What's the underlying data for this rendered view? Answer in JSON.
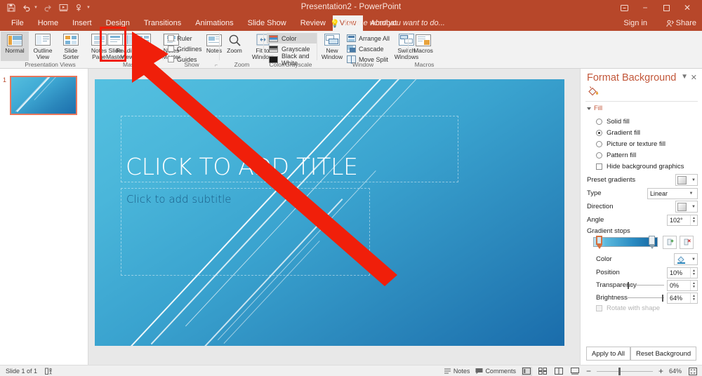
{
  "window": {
    "title": "Presentation2 - PowerPoint",
    "quick_access": [
      "save-icon",
      "undo-icon",
      "redo-icon",
      "start-presentation-icon",
      "touch-mode-icon",
      "customize-qat-icon"
    ],
    "controls": [
      "ribbon-display-options-icon",
      "minimize-icon",
      "restore-icon",
      "close-icon"
    ],
    "sign_in": "Sign in",
    "share": "Share",
    "accent_color": "#b7472a"
  },
  "tabs": [
    {
      "label": "File",
      "active": false
    },
    {
      "label": "Home",
      "active": false
    },
    {
      "label": "Insert",
      "active": false
    },
    {
      "label": "Design",
      "active": false
    },
    {
      "label": "Transitions",
      "active": false
    },
    {
      "label": "Animations",
      "active": false
    },
    {
      "label": "Slide Show",
      "active": false
    },
    {
      "label": "Review",
      "active": false
    },
    {
      "label": "View",
      "active": true
    },
    {
      "label": "Acrobat",
      "active": false
    }
  ],
  "tell_me": "Tell me what you want to do...",
  "ribbon": {
    "groups": [
      {
        "name": "Presentation Views",
        "label": "Presentation Views",
        "buttons": [
          {
            "label": "Normal",
            "selected": true
          },
          {
            "label": "Outline View",
            "selected": false
          },
          {
            "label": "Slide Sorter",
            "selected": false
          },
          {
            "label": "Notes Page",
            "selected": false
          },
          {
            "label": "Reading View",
            "selected": false
          }
        ]
      },
      {
        "name": "Master",
        "label": "Master",
        "buttons": [
          {
            "label": "Slide Master",
            "selected": false,
            "highlighted": true
          },
          {
            "label": "Handout Master",
            "selected": false
          },
          {
            "label": "Notes Master",
            "selected": false
          }
        ]
      },
      {
        "name": "Show",
        "label": "Show",
        "checkboxes": [
          {
            "label": "Ruler",
            "checked": false
          },
          {
            "label": "Gridlines",
            "checked": false
          },
          {
            "label": "Guides",
            "checked": false
          }
        ],
        "buttons": [
          {
            "label": "Notes",
            "selected": false
          }
        ],
        "has_dialog_launcher": true
      },
      {
        "name": "Zoom",
        "label": "Zoom",
        "buttons": [
          {
            "label": "Zoom",
            "selected": false
          },
          {
            "label": "Fit to Window",
            "selected": false
          }
        ]
      },
      {
        "name": "Color/Grayscale",
        "label": "Color/Grayscale",
        "options": [
          {
            "label": "Color",
            "selected": true
          },
          {
            "label": "Grayscale",
            "selected": false
          },
          {
            "label": "Black and White",
            "selected": false
          }
        ]
      },
      {
        "name": "Window",
        "label": "Window",
        "buttons": [
          {
            "label": "New Window",
            "selected": false
          },
          {
            "label": "Switch Windows",
            "selected": false
          }
        ],
        "items": [
          {
            "label": "Arrange All"
          },
          {
            "label": "Cascade"
          },
          {
            "label": "Move Split"
          }
        ]
      },
      {
        "name": "Macros",
        "label": "Macros",
        "buttons": [
          {
            "label": "Macros",
            "selected": false
          }
        ]
      }
    ]
  },
  "thumbnails": {
    "slides": [
      {
        "number": "1",
        "selected": true
      }
    ]
  },
  "slide": {
    "title_placeholder": "CLICK TO ADD TITLE",
    "subtitle_placeholder": "Click to add subtitle",
    "gradient_from": "#55c0e0",
    "gradient_to": "#1a6cab"
  },
  "format_pane": {
    "title": "Format Background",
    "section_fill": "Fill",
    "fill_options": [
      {
        "label": "Solid fill",
        "selected": false
      },
      {
        "label": "Gradient fill",
        "selected": true
      },
      {
        "label": "Picture or texture fill",
        "selected": false
      },
      {
        "label": "Pattern fill",
        "selected": false
      }
    ],
    "hide_background_graphics": {
      "label": "Hide background graphics",
      "checked": false
    },
    "preset_gradients_label": "Preset gradients",
    "type_label": "Type",
    "type_value": "Linear",
    "direction_label": "Direction",
    "angle_label": "Angle",
    "angle_value": "102°",
    "gradient_stops_label": "Gradient stops",
    "color_label": "Color",
    "position_label": "Position",
    "position_value": "10%",
    "transparency_label": "Transparency",
    "transparency_value": "0%",
    "brightness_label": "Brightness",
    "brightness_value": "64%",
    "rotate_with_shape": {
      "label": "Rotate with shape",
      "checked": false,
      "disabled": true
    },
    "apply_to_all": "Apply to All",
    "reset_background": "Reset Background"
  },
  "status_bar": {
    "slide_counter": "Slide 1 of 1",
    "accessibility_icon": "accessibility-checker-icon",
    "notes": "Notes",
    "comments": "Comments",
    "views": [
      "normal-view-icon",
      "slide-sorter-icon",
      "reading-view-icon",
      "slideshow-icon"
    ],
    "zoom_out": "−",
    "zoom_in": "+",
    "zoom_level": "64%",
    "fit_slide_icon": "fit-slide-to-window-icon"
  },
  "annotation": {
    "highlight_target": "Slide Master",
    "arrow_color": "#f01f0a"
  }
}
